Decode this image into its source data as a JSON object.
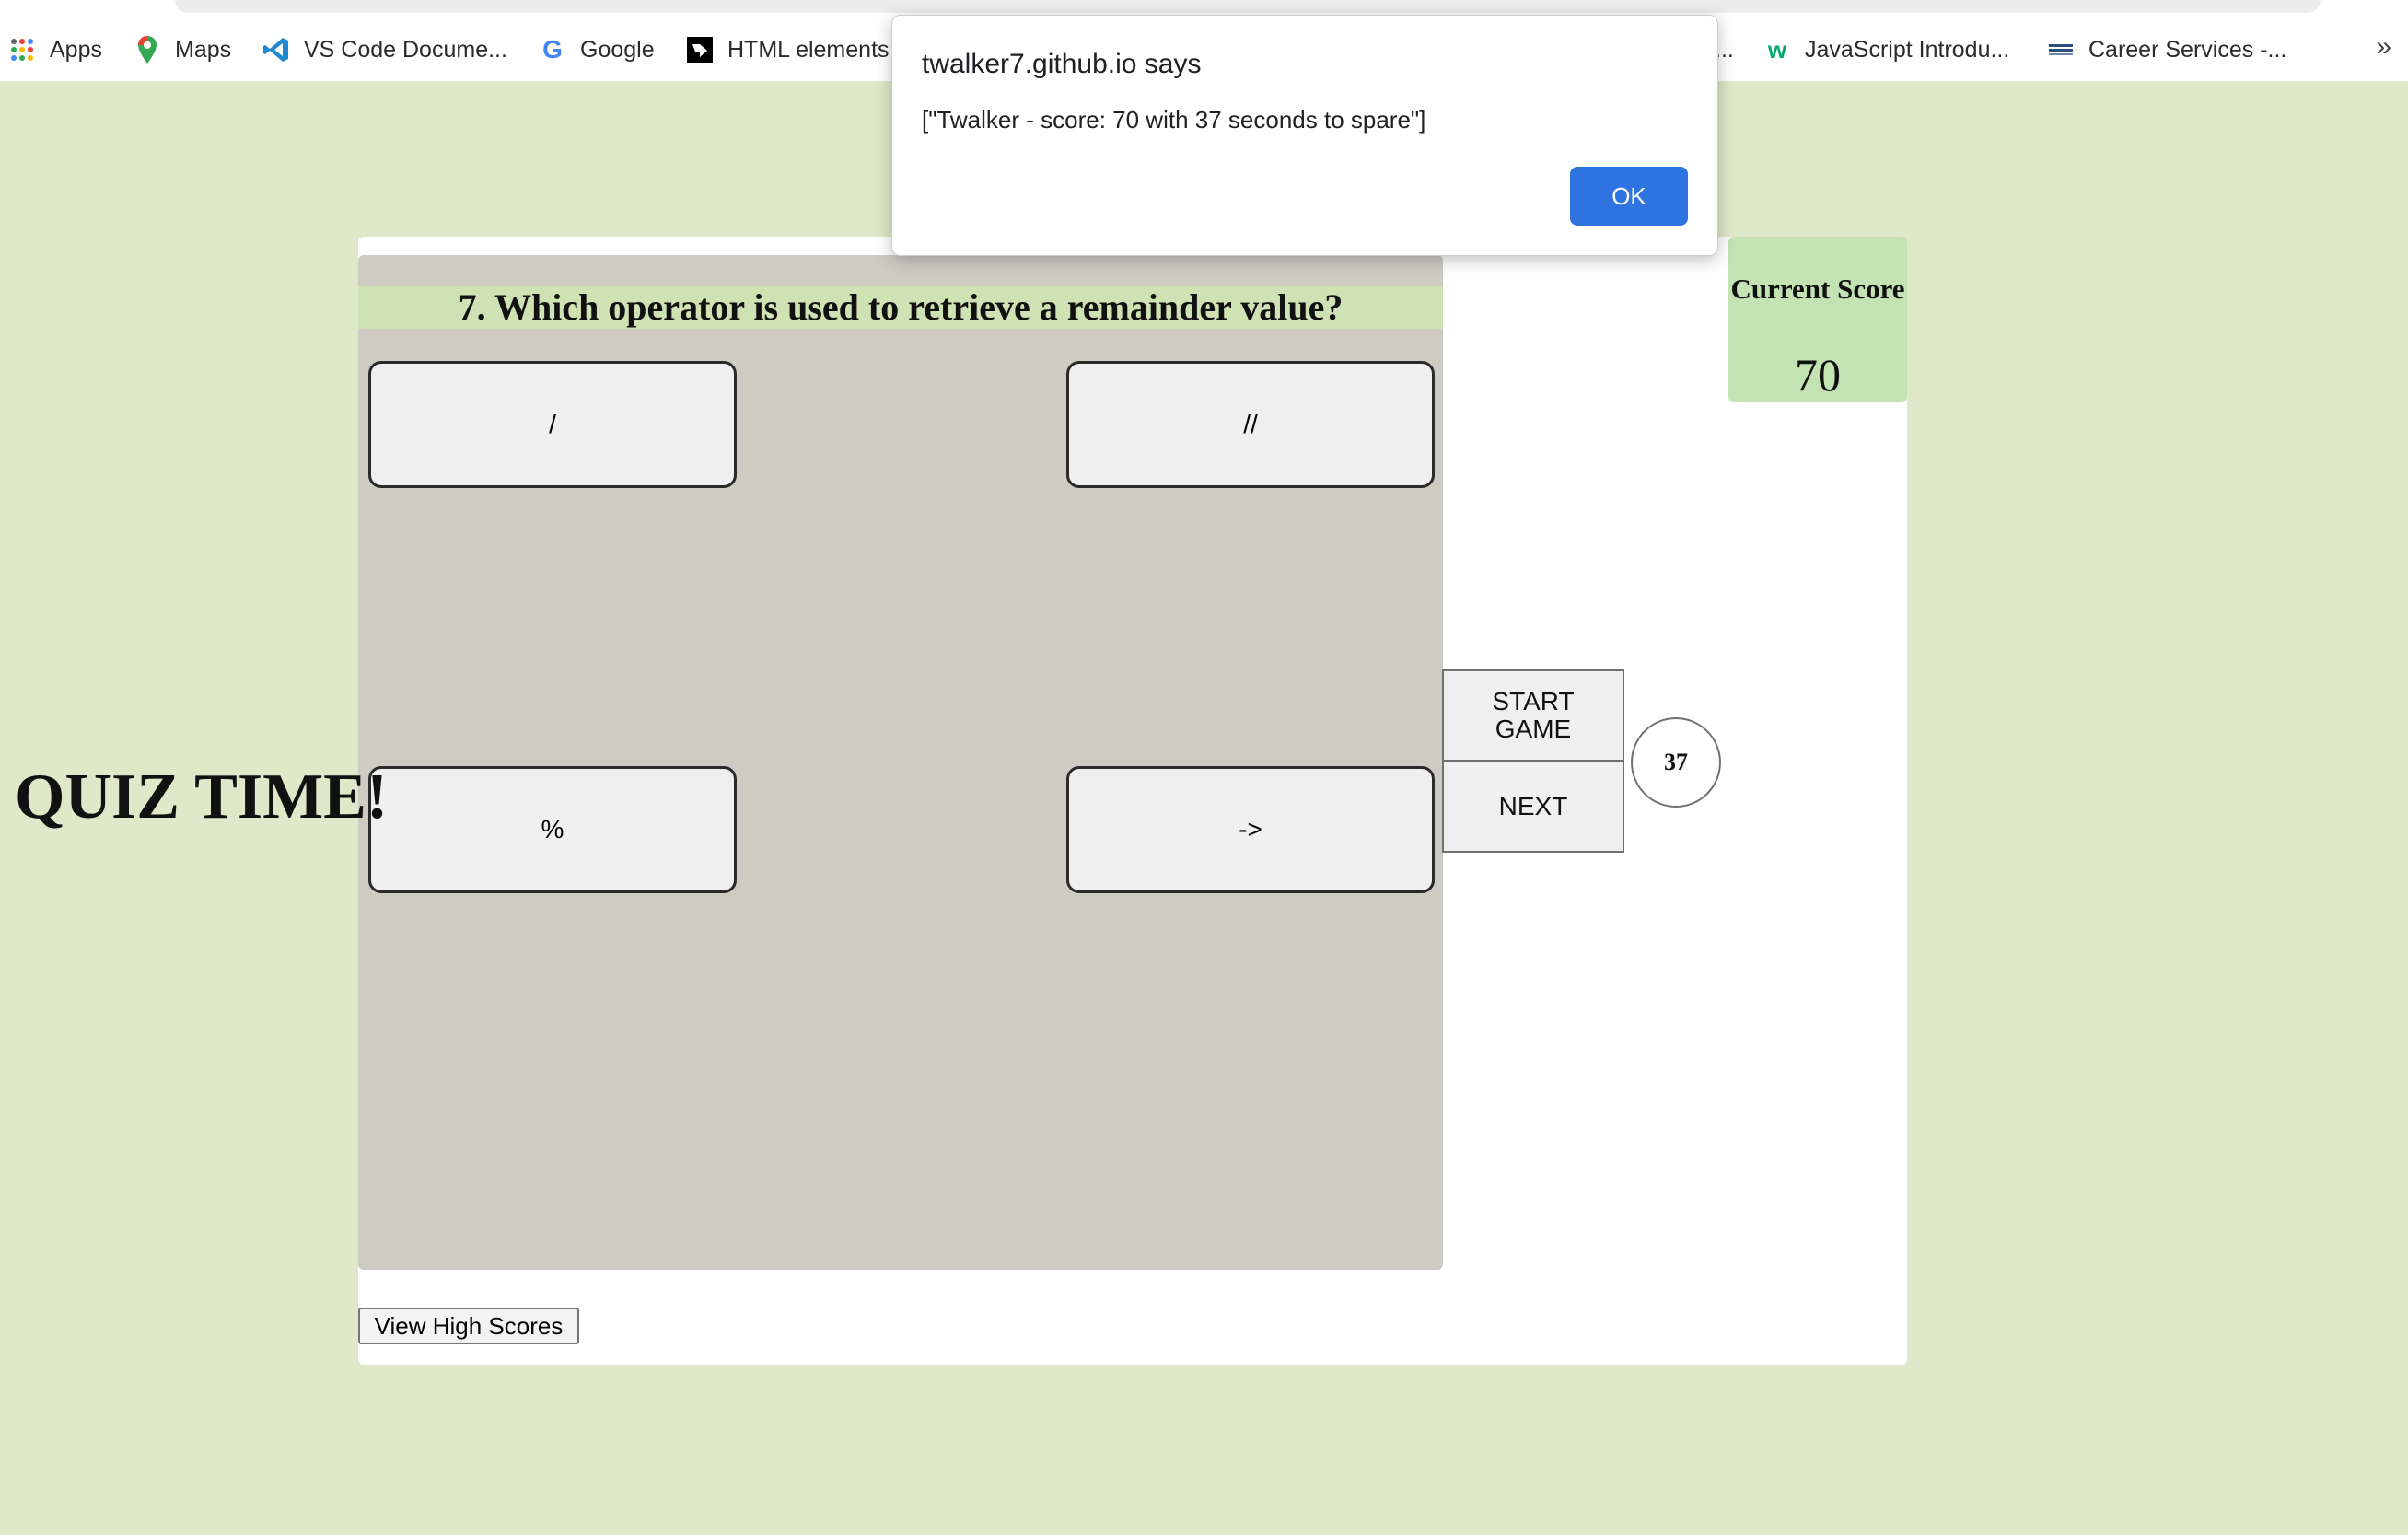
{
  "bookmarks": [
    {
      "label": "Apps",
      "icon": "apps-grid-icon"
    },
    {
      "label": "Maps",
      "icon": "maps-pin-icon"
    },
    {
      "label": "VS Code Docume...",
      "icon": "vscode-icon"
    },
    {
      "label": "Google",
      "icon": "google-icon"
    },
    {
      "label": "HTML elements",
      "icon": "mdn-icon"
    },
    {
      "label": "...",
      "icon": ""
    },
    {
      "label": "JavaScript Introdu...",
      "icon": "w3schools-icon"
    },
    {
      "label": "Career Services -...",
      "icon": "career-services-icon"
    }
  ],
  "overflow": "»",
  "page": {
    "title": "QUIZ TIME!",
    "question": "7. Which operator is used to retrieve a remainder value?",
    "answers": [
      "/",
      "//",
      "%",
      "->"
    ],
    "start_label": "START GAME",
    "next_label": "NEXT",
    "timer": "37",
    "score_label": "Current Score",
    "score_value": "70",
    "high_scores_label": "View High Scores"
  },
  "dialog": {
    "title": "twalker7.github.io says",
    "message": "[\"Twalker - score: 70 with 37 seconds to spare\"]",
    "ok_label": "OK"
  },
  "colors": {
    "background": "#dfe8c9",
    "quiz_area": "#cdcbc2",
    "question_bar": "#cfe2b4",
    "score_box": "#c3e3b3",
    "ok_button": "#2f73e0"
  }
}
